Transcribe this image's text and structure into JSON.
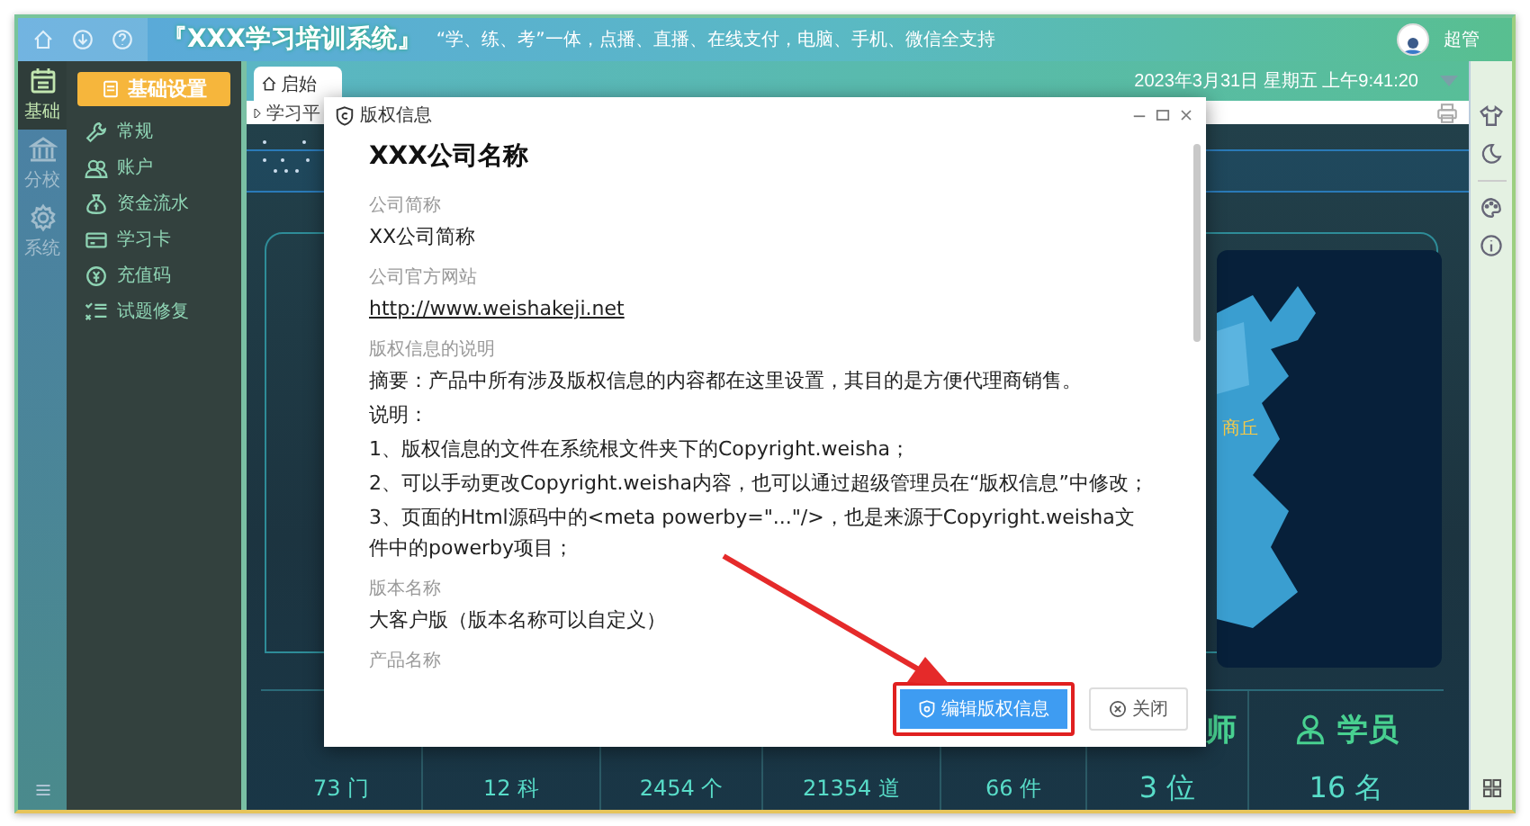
{
  "header": {
    "title": "『XXX学习培训系统』",
    "slogan": "“学、练、考”一体，点播、直播、在线支付，电脑、手机、微信全支持",
    "user": "超管"
  },
  "rail": [
    {
      "label": "基础",
      "selected": true
    },
    {
      "label": "分校",
      "selected": false
    },
    {
      "label": "系统",
      "selected": false
    }
  ],
  "menu": {
    "heading": "基础设置",
    "items": [
      {
        "label": "常规"
      },
      {
        "label": "账户"
      },
      {
        "label": "资金流水"
      },
      {
        "label": "学习卡"
      },
      {
        "label": "充值码"
      },
      {
        "label": "试题修复"
      }
    ]
  },
  "tabs": [
    {
      "label": "启始",
      "selected": true
    }
  ],
  "datetime": "2023年3月31日 星期五 上午9:41:20",
  "address": "学习平",
  "dashboard": {
    "map_label": "商丘",
    "stats": [
      {
        "value": "73 门"
      },
      {
        "value": "12 科"
      },
      {
        "value": "2454 个"
      },
      {
        "value": "21354 道"
      },
      {
        "value": "66 件"
      },
      {
        "value": "3 位",
        "heading": "师"
      },
      {
        "value": "16 名",
        "heading": "学员"
      }
    ]
  },
  "dialog": {
    "title": "版权信息",
    "company": "XXX公司名称",
    "fields": [
      {
        "label": "公司简称",
        "kind": "text",
        "value": "XX公司简称"
      },
      {
        "label": "公司官方网站",
        "kind": "link",
        "value": "http://www.weishakeji.net"
      },
      {
        "label": "版权信息的说明",
        "kind": "lines",
        "lines": [
          "摘要：产品中所有涉及版权信息的内容都在这里设置，其目的是方便代理商销售。",
          "说明：",
          "1、版权信息的文件在系统根文件夹下的Copyright.weisha；",
          "2、可以手动更改Copyright.weisha内容，也可以通过超级管理员在“版权信息”中修改；",
          "3、页面的Html源码中的<meta powerby=\"...\"/>，也是来源于Copyright.weisha文件中的powerby项目；"
        ]
      },
      {
        "label": "版本名称",
        "kind": "text",
        "value": "大客户版（版本名称可以自定义）"
      },
      {
        "label": "产品名称",
        "kind": "empty"
      }
    ],
    "buttons": [
      {
        "label": "编辑版权信息",
        "kind": "primary",
        "highlighted": true
      },
      {
        "label": "关闭",
        "kind": "secondary",
        "highlighted": false
      }
    ]
  }
}
